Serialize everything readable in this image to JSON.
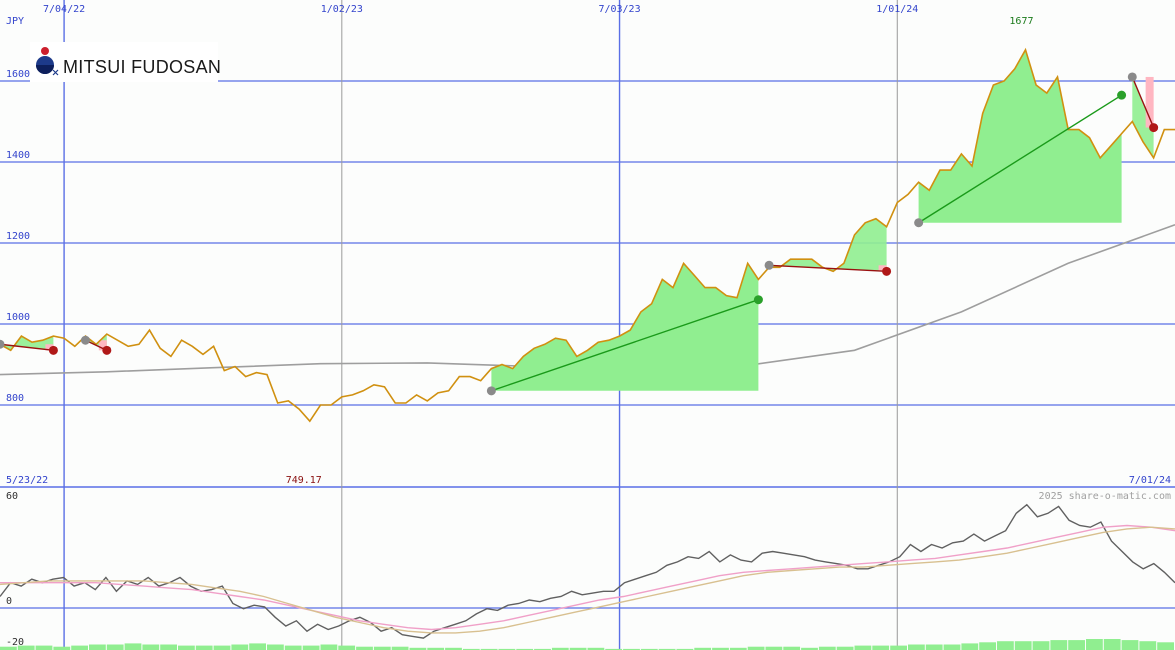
{
  "logo": {
    "text": "MITSUI FUDOSAN"
  },
  "currency": "JPY",
  "watermark": "2025 share-o-matic.com",
  "colors": {
    "background": "#fcfdfc",
    "grid": "#5a6fe6",
    "price": "#d09010",
    "ma": "#9e9e9e",
    "gain_fill": "#90ee90",
    "loss_fill": "#ffb6c1",
    "gain_line": "#1a9a1a",
    "loss_line": "#9a1010",
    "axis_text": "#3344cc",
    "peak_text": "#1a7a1a",
    "low_text": "#8a1010",
    "osc": "#606060",
    "osc_pink": "#f0a0c8",
    "osc_tan": "#d8c090"
  },
  "chart_data": [
    {
      "type": "line",
      "title": "",
      "ylabel": "JPY",
      "ylim": [
        730,
        1700
      ],
      "x_top_ticks": [
        "7/04/22",
        "1/02/23",
        "7/03/23",
        "1/01/24"
      ],
      "x_bottom_labels": [
        "5/23/22",
        "7/01/24"
      ],
      "y_ticks": [
        800,
        1000,
        1200,
        1400,
        1600
      ],
      "annotations": {
        "high": "1677",
        "low": "749.17"
      },
      "grid": true,
      "series": [
        {
          "style": "price-line",
          "x": [
            "2022-05-23",
            "2022-05-30",
            "2022-06-06",
            "2022-06-13",
            "2022-06-20",
            "2022-06-27",
            "2022-07-04",
            "2022-07-11",
            "2022-07-18",
            "2022-07-25",
            "2022-08-01",
            "2022-08-08",
            "2022-08-15",
            "2022-08-22",
            "2022-08-29",
            "2022-09-05",
            "2022-09-12",
            "2022-09-19",
            "2022-09-26",
            "2022-10-03",
            "2022-10-10",
            "2022-10-17",
            "2022-10-24",
            "2022-10-31",
            "2022-11-07",
            "2022-11-14",
            "2022-11-21",
            "2022-11-28",
            "2022-12-05",
            "2022-12-12",
            "2022-12-19",
            "2022-12-26",
            "2023-01-02",
            "2023-01-09",
            "2023-01-16",
            "2023-01-23",
            "2023-01-30",
            "2023-02-06",
            "2023-02-13",
            "2023-02-20",
            "2023-02-27",
            "2023-03-06",
            "2023-03-13",
            "2023-03-20",
            "2023-03-27",
            "2023-04-03",
            "2023-04-10",
            "2023-04-17",
            "2023-04-24",
            "2023-05-01",
            "2023-05-08",
            "2023-05-15",
            "2023-05-22",
            "2023-05-29",
            "2023-06-05",
            "2023-06-12",
            "2023-06-19",
            "2023-06-26",
            "2023-07-03",
            "2023-07-10",
            "2023-07-17",
            "2023-07-24",
            "2023-07-31",
            "2023-08-07",
            "2023-08-14",
            "2023-08-21",
            "2023-08-28",
            "2023-09-04",
            "2023-09-11",
            "2023-09-18",
            "2023-09-25",
            "2023-10-02",
            "2023-10-09",
            "2023-10-16",
            "2023-10-23",
            "2023-10-30",
            "2023-11-06",
            "2023-11-13",
            "2023-11-20",
            "2023-11-27",
            "2023-12-04",
            "2023-12-11",
            "2023-12-18",
            "2023-12-25",
            "2024-01-01",
            "2024-01-08",
            "2024-01-15",
            "2024-01-22",
            "2024-01-29",
            "2024-02-05",
            "2024-02-12",
            "2024-02-19",
            "2024-02-26",
            "2024-03-04",
            "2024-03-11",
            "2024-03-18",
            "2024-03-25",
            "2024-04-01",
            "2024-04-08",
            "2024-04-15",
            "2024-04-22",
            "2024-04-29",
            "2024-05-06",
            "2024-05-13",
            "2024-05-20",
            "2024-05-27",
            "2024-06-03",
            "2024-06-10",
            "2024-06-17",
            "2024-06-24",
            "2024-07-01"
          ],
          "values": [
            950,
            935,
            970,
            955,
            960,
            970,
            965,
            945,
            970,
            950,
            975,
            960,
            945,
            950,
            985,
            940,
            920,
            960,
            945,
            925,
            945,
            885,
            895,
            870,
            880,
            875,
            805,
            810,
            790,
            760,
            800,
            800,
            820,
            825,
            835,
            850,
            845,
            805,
            805,
            825,
            810,
            830,
            835,
            870,
            870,
            860,
            890,
            900,
            890,
            920,
            940,
            950,
            965,
            960,
            920,
            935,
            955,
            960,
            970,
            985,
            1030,
            1050,
            1110,
            1090,
            1150,
            1120,
            1090,
            1090,
            1070,
            1065,
            1150,
            1110,
            1140,
            1140,
            1160,
            1160,
            1160,
            1140,
            1130,
            1150,
            1220,
            1250,
            1260,
            1240,
            1300,
            1320,
            1350,
            1330,
            1380,
            1380,
            1420,
            1390,
            1520,
            1590,
            1600,
            1630,
            1677,
            1590,
            1570,
            1610,
            1480,
            1480,
            1460,
            1410,
            1440,
            1470,
            1500,
            1450,
            1410,
            1480,
            1480
          ]
        },
        {
          "style": "moving-average",
          "x": [
            "2022-05-23",
            "2022-08-01",
            "2022-10-10",
            "2022-12-19",
            "2023-02-27",
            "2023-05-08",
            "2023-07-17",
            "2023-09-25",
            "2023-12-04",
            "2024-02-12",
            "2024-04-22",
            "2024-07-01"
          ],
          "values": [
            875,
            882,
            892,
            902,
            904,
            895,
            885,
            898,
            935,
            1030,
            1150,
            1245
          ]
        }
      ],
      "trades": [
        {
          "from": "2022-05-23",
          "from_value": 950,
          "to": "2022-06-27",
          "to_value": 935,
          "result": "loss"
        },
        {
          "from": "2022-07-18",
          "from_value": 960,
          "to": "2022-08-01",
          "to_value": 935,
          "result": "loss"
        },
        {
          "from": "2023-04-10",
          "from_value": 835,
          "to": "2023-10-02",
          "to_value": 1060,
          "result": "gain"
        },
        {
          "from": "2023-10-09",
          "from_value": 1145,
          "to": "2023-12-25",
          "to_value": 1130,
          "result": "loss"
        },
        {
          "from": "2024-01-15",
          "from_value": 1250,
          "to": "2024-05-27",
          "to_value": 1565,
          "result": "gain"
        },
        {
          "from": "2024-06-03",
          "from_value": 1610,
          "to": "2024-06-17",
          "to_value": 1485,
          "result": "loss"
        }
      ]
    },
    {
      "type": "line",
      "title": "",
      "ylim": [
        -20,
        60
      ],
      "y_ticks": [
        -20,
        0,
        60
      ],
      "grid": true,
      "series": [
        {
          "style": "oscillator",
          "values": [
            2,
            10,
            8,
            12,
            10,
            12,
            13,
            8,
            10,
            6,
            13,
            5,
            11,
            9,
            13,
            8,
            10,
            13,
            8,
            5,
            6,
            8,
            -2,
            -5,
            -3,
            -4,
            -10,
            -15,
            -12,
            -18,
            -14,
            -17,
            -15,
            -12,
            -10,
            -13,
            -18,
            -16,
            -20,
            -21,
            -22,
            -18,
            -16,
            -14,
            -12,
            -8,
            -5,
            -6,
            -3,
            -2,
            0,
            -1,
            1,
            2,
            5,
            3,
            4,
            5,
            5,
            10,
            12,
            14,
            16,
            20,
            22,
            25,
            24,
            28,
            22,
            26,
            23,
            22,
            27,
            28,
            27,
            26,
            25,
            23,
            22,
            21,
            20,
            18,
            18,
            20,
            22,
            25,
            32,
            28,
            32,
            30,
            33,
            34,
            38,
            34,
            37,
            40,
            50,
            55,
            48,
            50,
            54,
            46,
            43,
            42,
            45,
            34,
            28,
            22,
            18,
            21,
            16,
            10
          ]
        },
        {
          "style": "signal-pink",
          "values": [
            10,
            10,
            10,
            10,
            10,
            9,
            8,
            7,
            6,
            4,
            2,
            0,
            -3,
            -6,
            -9,
            -12,
            -14,
            -16,
            -17,
            -16,
            -14,
            -12,
            -9,
            -6,
            -3,
            0,
            2,
            5,
            8,
            11,
            14,
            16,
            17,
            18,
            19,
            20,
            21,
            22,
            23,
            24,
            26,
            28,
            30,
            33,
            36,
            39,
            42,
            43,
            42,
            40
          ]
        },
        {
          "style": "signal-tan",
          "values": [
            9,
            10,
            11,
            11,
            11,
            11,
            11,
            10,
            9,
            7,
            5,
            2,
            -2,
            -6,
            -10,
            -13,
            -16,
            -18,
            -19,
            -19,
            -18,
            -16,
            -13,
            -10,
            -7,
            -4,
            -1,
            2,
            5,
            8,
            11,
            14,
            16,
            17,
            18,
            19,
            19,
            20,
            21,
            22,
            23,
            25,
            27,
            30,
            33,
            36,
            39,
            41,
            42,
            41
          ]
        },
        {
          "style": "volume-bars",
          "values": [
            3,
            4,
            4,
            3,
            4,
            5,
            5,
            6,
            5,
            5,
            4,
            4,
            4,
            5,
            6,
            5,
            4,
            4,
            5,
            4,
            3,
            3,
            3,
            2,
            2,
            2,
            1,
            1,
            1,
            1,
            1,
            2,
            2,
            2,
            1,
            1,
            1,
            1,
            1,
            2,
            2,
            2,
            3,
            3,
            3,
            2,
            3,
            3,
            4,
            4,
            4,
            5,
            5,
            5,
            6,
            7,
            8,
            8,
            8,
            9,
            9,
            10,
            10,
            9,
            8,
            7
          ]
        }
      ]
    }
  ]
}
